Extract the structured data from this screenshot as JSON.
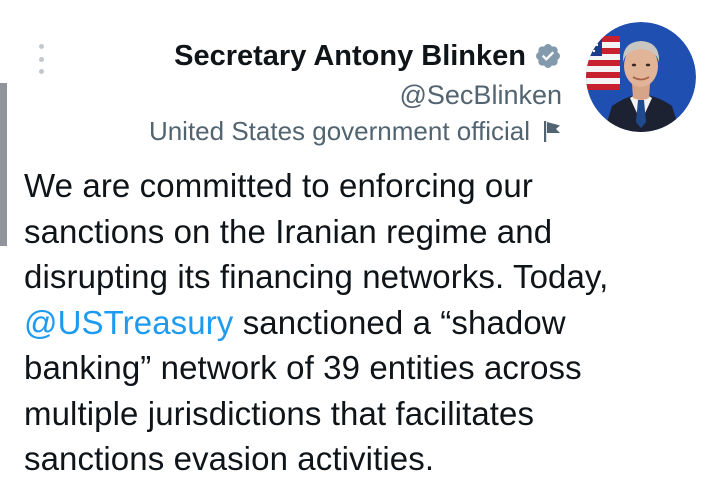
{
  "author": {
    "name": "Secretary Antony Blinken",
    "handle": "@SecBlinken",
    "affiliation": "United States government official"
  },
  "icons": {
    "more": "vertical-dots-icon",
    "verified": "gray-verified-badge-icon",
    "affiliation": "flag-icon"
  },
  "colors": {
    "link": "#1d9bf0",
    "text": "#0f1419",
    "secondary": "#536471",
    "verified_badge": "#829aab"
  },
  "tweet": {
    "line1": "We are committed to enforcing our",
    "line2": "sanctions on the Iranian regime and",
    "line3": "disrupting its financing networks. Today,",
    "mention": "@USTreasury",
    "line4_rest": " sanctioned a “shadow",
    "line5": "banking” network of 39 entities across",
    "line6": "multiple jurisdictions that facilitates",
    "line7": "sanctions evasion activities."
  }
}
